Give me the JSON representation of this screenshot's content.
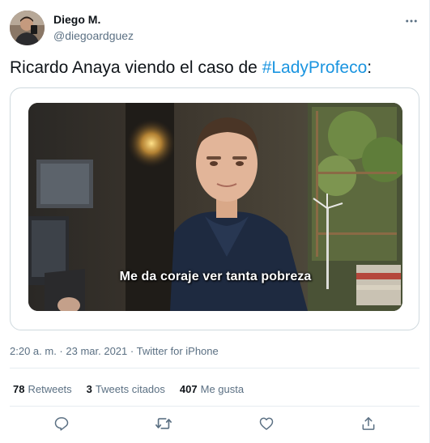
{
  "author": {
    "name": "Diego M.",
    "handle": "@diegoardguez"
  },
  "tweet": {
    "text_prefix": "Ricardo Anaya viendo el caso de ",
    "hashtag": "#LadyProfeco",
    "text_suffix": ":"
  },
  "media": {
    "subtitle": "Me da coraje ver tanta pobreza"
  },
  "meta": {
    "time": "2:20 a. m.",
    "separator1": " · ",
    "date": "23 mar. 2021",
    "separator2": " · ",
    "source": "Twitter for iPhone"
  },
  "stats": {
    "retweets_count": "78",
    "retweets_label": "Retweets",
    "quotes_count": "3",
    "quotes_label": "Tweets citados",
    "likes_count": "407",
    "likes_label": "Me gusta"
  },
  "icons": {
    "more": "more-horizontal-icon",
    "reply": "reply-icon",
    "retweet": "retweet-icon",
    "like": "heart-icon",
    "share": "share-icon"
  },
  "colors": {
    "accent": "#1b95e0",
    "secondary_text": "#5b7083",
    "primary_text": "#0f1419",
    "border": "#cfd9de"
  }
}
